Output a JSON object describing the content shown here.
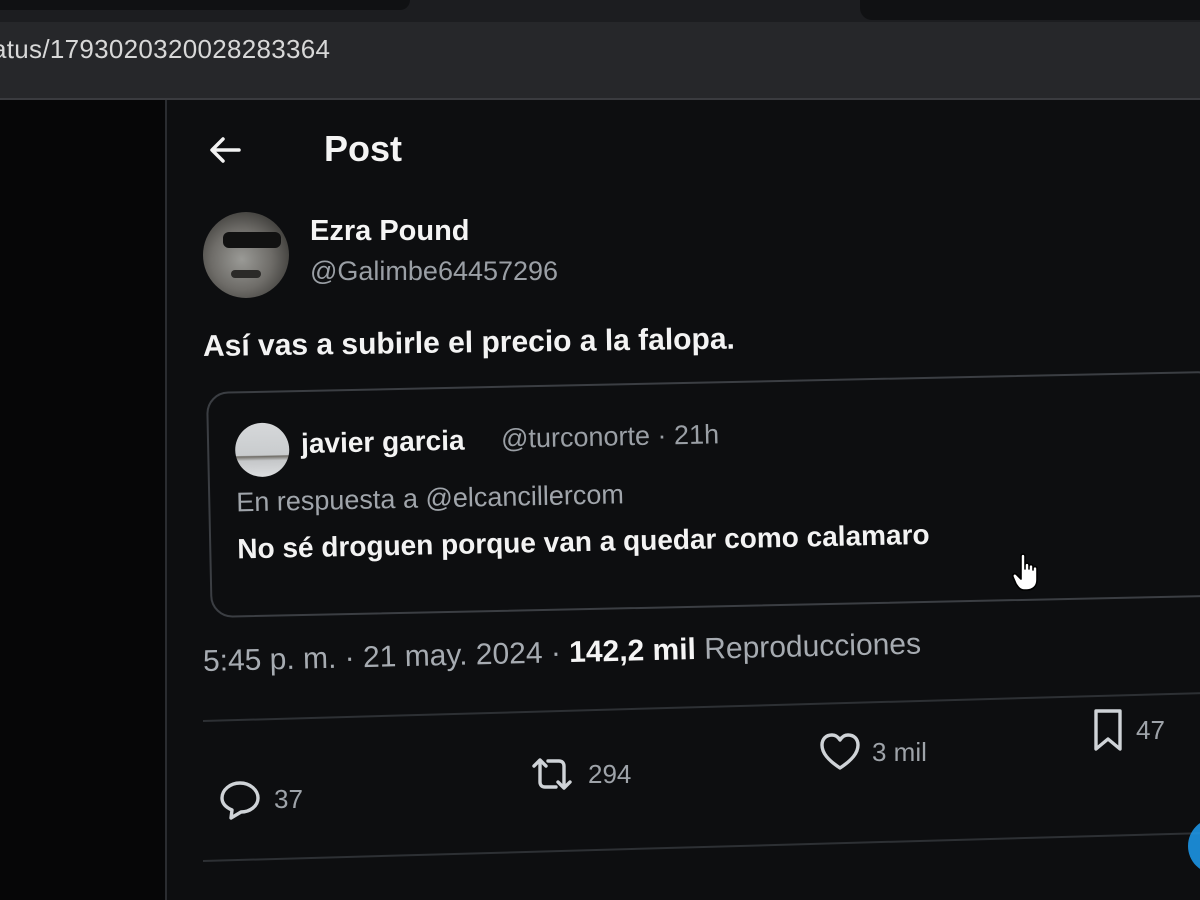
{
  "browser": {
    "url_visible": "atus/1793020320028283364"
  },
  "header": {
    "back_icon": "arrow-left-icon",
    "title": "Post"
  },
  "post": {
    "author_name": "Ezra Pound",
    "author_handle": "@Galimbe64457296",
    "text": "Así vas a subirle el precio a la falopa.",
    "time": "5:45 p. m.",
    "date": "21 may. 2024",
    "views_count": "142,2 mil",
    "views_label": "Reproducciones",
    "separator": " · "
  },
  "quoted_post": {
    "author_name": "javier garcia",
    "author_handle": "@turconorte",
    "age": "21h",
    "reply_to": "En respuesta a @elcancillercom",
    "text": "No sé droguen porque van a quedar como calamaro"
  },
  "actions": {
    "replies": "37",
    "reposts": "294",
    "likes": "3 mil",
    "bookmarks": "47"
  },
  "colors": {
    "background": "#0d0e10",
    "text_primary": "#f3f3f3",
    "text_secondary": "#9a9fa5",
    "border": "#3b3e43"
  }
}
